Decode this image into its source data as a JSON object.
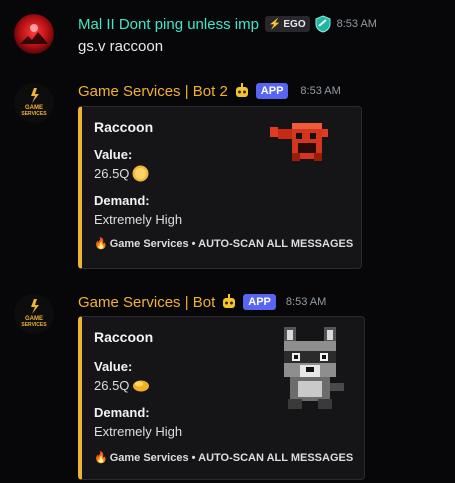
{
  "messages": [
    {
      "username": "Mal II Dont ping unless imp",
      "username_color": "#3ee8c9",
      "tag_text": "EGO",
      "timestamp": "8:53 AM",
      "content": "gs.v raccoon"
    },
    {
      "username": "Game Services | Bot 2",
      "username_color": "#f0b232",
      "app_label": "APP",
      "timestamp": "8:53 AM",
      "avatar_text": "GAME SERVICES",
      "embed": {
        "title": "Raccoon",
        "value_label": "Value:",
        "value": "26.5Q",
        "demand_label": "Demand:",
        "demand": "Extremely High",
        "footer": "Game Services • AUTO-SCAN ALL MESSAGES"
      }
    },
    {
      "username": "Game Services | Bot",
      "username_color": "#f0b232",
      "app_label": "APP",
      "timestamp": "8:53 AM",
      "avatar_text": "GAME SERVICES",
      "embed": {
        "title": "Raccoon",
        "value_label": "Value:",
        "value": "26.5Q",
        "demand_label": "Demand:",
        "demand": "Extremely High",
        "footer": "Game Services • AUTO-SCAN ALL MESSAGES"
      }
    }
  ],
  "colors": {
    "accent": "#f0b232",
    "app_badge": "#5865f2",
    "background": "#070709"
  }
}
